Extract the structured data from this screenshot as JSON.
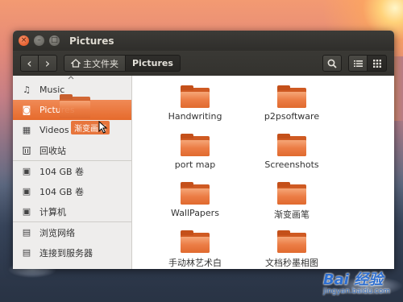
{
  "window": {
    "title": "Pictures",
    "close_glyph": "×",
    "min_glyph": "–",
    "max_glyph": "□"
  },
  "toolbar": {
    "back_glyph": "‹",
    "forward_glyph": "›",
    "breadcrumbs": [
      {
        "label": "主文件夹",
        "icon": "home-icon"
      },
      {
        "label": "Pictures"
      }
    ],
    "search_icon": "search-icon",
    "list_view_icon": "list-view-icon",
    "grid_view_icon": "grid-view-icon"
  },
  "sidebar": {
    "items": [
      {
        "label": "Music",
        "icon": "music-icon",
        "glyph": "♫"
      },
      {
        "label": "Pictures",
        "icon": "camera-icon",
        "glyph": "◙",
        "active": true
      },
      {
        "label": "Videos",
        "icon": "video-icon",
        "glyph": "▦"
      },
      {
        "label": "回收站",
        "icon": "trash-icon",
        "glyph": "🗑"
      },
      {
        "label": "104 GB 卷",
        "icon": "drive-icon",
        "glyph": "▣"
      },
      {
        "label": "104 GB 卷",
        "icon": "drive-icon",
        "glyph": "▣"
      },
      {
        "label": "计算机",
        "icon": "computer-icon",
        "glyph": "▣"
      },
      {
        "label": "浏览网络",
        "icon": "network-icon",
        "glyph": "▤"
      },
      {
        "label": "连接到服务器",
        "icon": "server-icon",
        "glyph": "▤"
      }
    ]
  },
  "files": [
    {
      "name": "Handwriting"
    },
    {
      "name": "p2psoftware"
    },
    {
      "name": "port map"
    },
    {
      "name": "Screenshots"
    },
    {
      "name": "WallPapers"
    },
    {
      "name": "渐变画笔"
    },
    {
      "name": "手动林艺术白"
    },
    {
      "name": "文档秒墨相图"
    }
  ],
  "drag": {
    "label": "渐变画笔"
  },
  "watermark": {
    "main": "Bai 经验",
    "sub": "jingyan.baidu.com"
  },
  "colors": {
    "accent": "#e66a2c",
    "titlebar": "#3c3b37"
  }
}
